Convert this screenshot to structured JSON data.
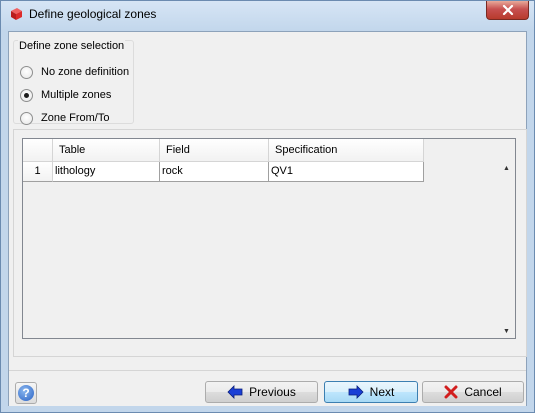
{
  "window": {
    "title": "Define geological zones",
    "icon": "red-cube-icon"
  },
  "zone_selection": {
    "label": "Define zone selection",
    "options": [
      {
        "label": "No zone definition",
        "checked": false
      },
      {
        "label": "Multiple zones",
        "checked": true
      },
      {
        "label": "Zone From/To",
        "checked": false
      }
    ]
  },
  "grid": {
    "columns": [
      "",
      "Table",
      "Field",
      "Specification"
    ],
    "rows": [
      {
        "num": "1",
        "table": "lithology",
        "field": "rock",
        "specification": "QV1"
      }
    ]
  },
  "buttons": {
    "previous": "Previous",
    "next": "Next",
    "cancel": "Cancel",
    "help": "?"
  },
  "colors": {
    "arrow_blue": "#1a3fd6",
    "cancel_red": "#d21e1e"
  }
}
